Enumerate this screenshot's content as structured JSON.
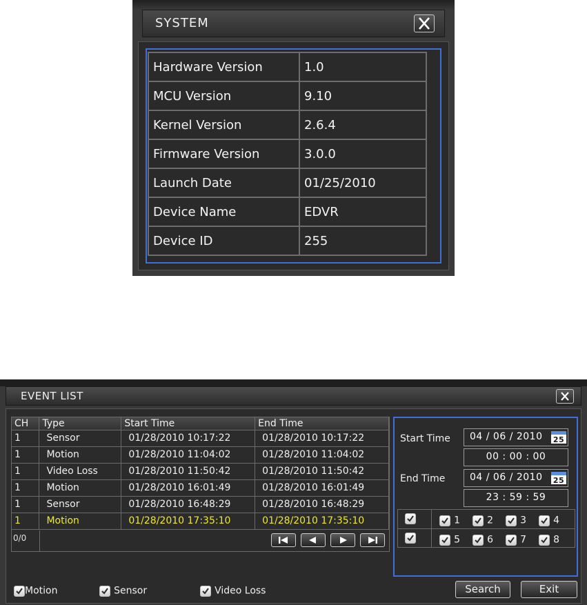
{
  "system": {
    "title": "SYSTEM",
    "close_icon": "close-x-icon",
    "rows": [
      {
        "label": "Hardware Version",
        "value": "1.0"
      },
      {
        "label": "MCU Version",
        "value": "9.10"
      },
      {
        "label": "Kernel Version",
        "value": "2.6.4"
      },
      {
        "label": "Firmware Version",
        "value": "3.0.0"
      },
      {
        "label": "Launch Date",
        "value": "01/25/2010"
      },
      {
        "label": "Device Name",
        "value": "EDVR"
      },
      {
        "label": "Device ID",
        "value": "255"
      }
    ]
  },
  "event_list": {
    "title": "EVENT LIST",
    "columns": [
      "CH",
      "Type",
      "Start Time",
      "End Time"
    ],
    "rows": [
      {
        "ch": "1",
        "type": "Sensor",
        "start": "01/28/2010  10:17:22",
        "end": "01/28/2010  10:17:22"
      },
      {
        "ch": "1",
        "type": "Motion",
        "start": "01/28/2010  11:04:02",
        "end": "01/28/2010  11:04:02"
      },
      {
        "ch": "1",
        "type": "Video Loss",
        "start": "01/28/2010  11:50:42",
        "end": "01/28/2010  11:50:42"
      },
      {
        "ch": "1",
        "type": "Motion",
        "start": "01/28/2010  16:01:49",
        "end": "01/28/2010  16:01:49"
      },
      {
        "ch": "1",
        "type": "Sensor",
        "start": "01/28/2010  16:48:29",
        "end": "01/28/2010  16:48:29"
      },
      {
        "ch": "1",
        "type": "Motion",
        "start": "01/28/2010  17:35:10",
        "end": "01/28/2010  17:35:10"
      }
    ],
    "selected_row_color": "#f2ea1c",
    "pager": "0/0",
    "search": {
      "start_label": "Start Time",
      "start_date": "04 / 06 / 2010",
      "start_time": "00  :  00  :  00",
      "end_label": "End Time",
      "end_date": "04 / 06 / 2010",
      "end_time": "23  :  59  :  59",
      "calendar_day": "25"
    },
    "channels": [
      "1",
      "2",
      "3",
      "4",
      "5",
      "6",
      "7",
      "8"
    ],
    "filters": [
      "Motion",
      "Sensor",
      "Video Loss"
    ],
    "search_button": "Search",
    "exit_button": "Exit"
  }
}
